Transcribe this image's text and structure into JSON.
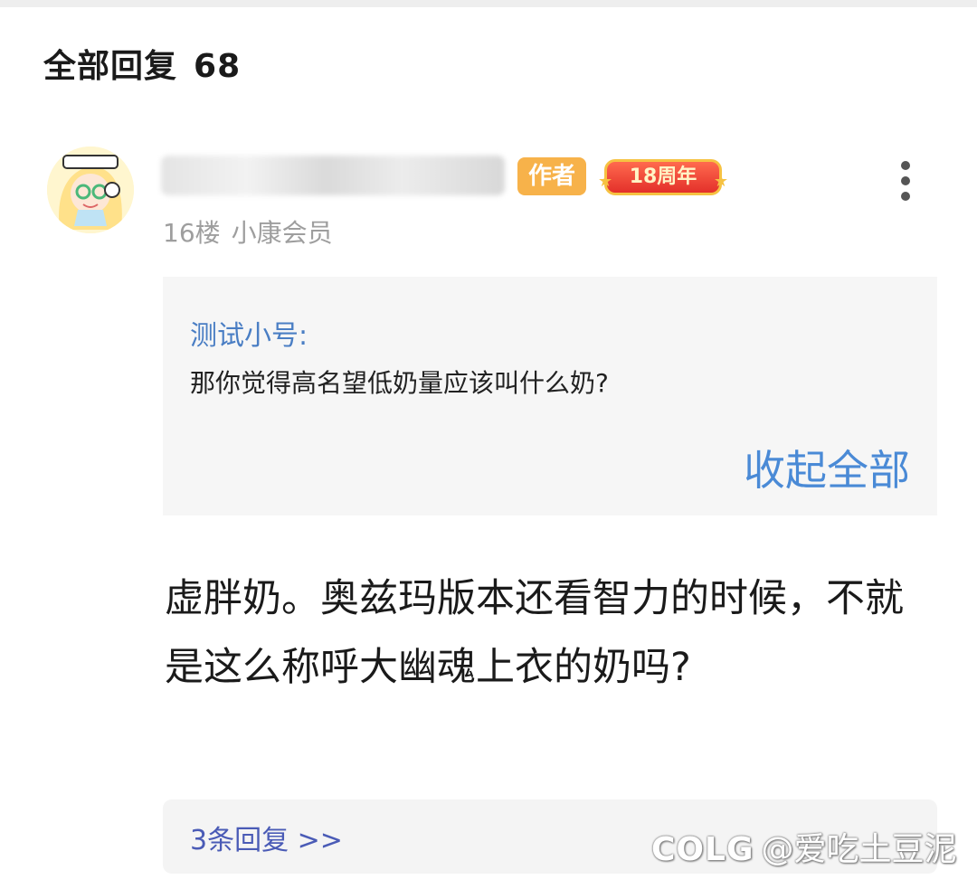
{
  "header": {
    "title": "全部回复",
    "count": "68"
  },
  "post": {
    "author_badge": "作者",
    "anniversary_badge": "18周年",
    "floor": "16楼",
    "membership": "小康会员",
    "quote": {
      "author": "测试小号:",
      "text": "那你觉得高名望低奶量应该叫什么奶?",
      "collapse_label": "收起全部"
    },
    "body": "虚胖奶。奥兹玛版本还看智力的时候，不就是这么称呼大幽魂上衣的奶吗?",
    "subreply_label": "3条回复 >>"
  },
  "watermark": {
    "logo": "COLG",
    "handle": "@爱吃土豆泥"
  },
  "icons": {
    "more": "more-vertical-icon",
    "avatar": "avatar-image"
  },
  "colors": {
    "link_blue": "#4a8ad6",
    "author_badge": "#f7b24a",
    "anniv_badge": "#e3302a"
  }
}
